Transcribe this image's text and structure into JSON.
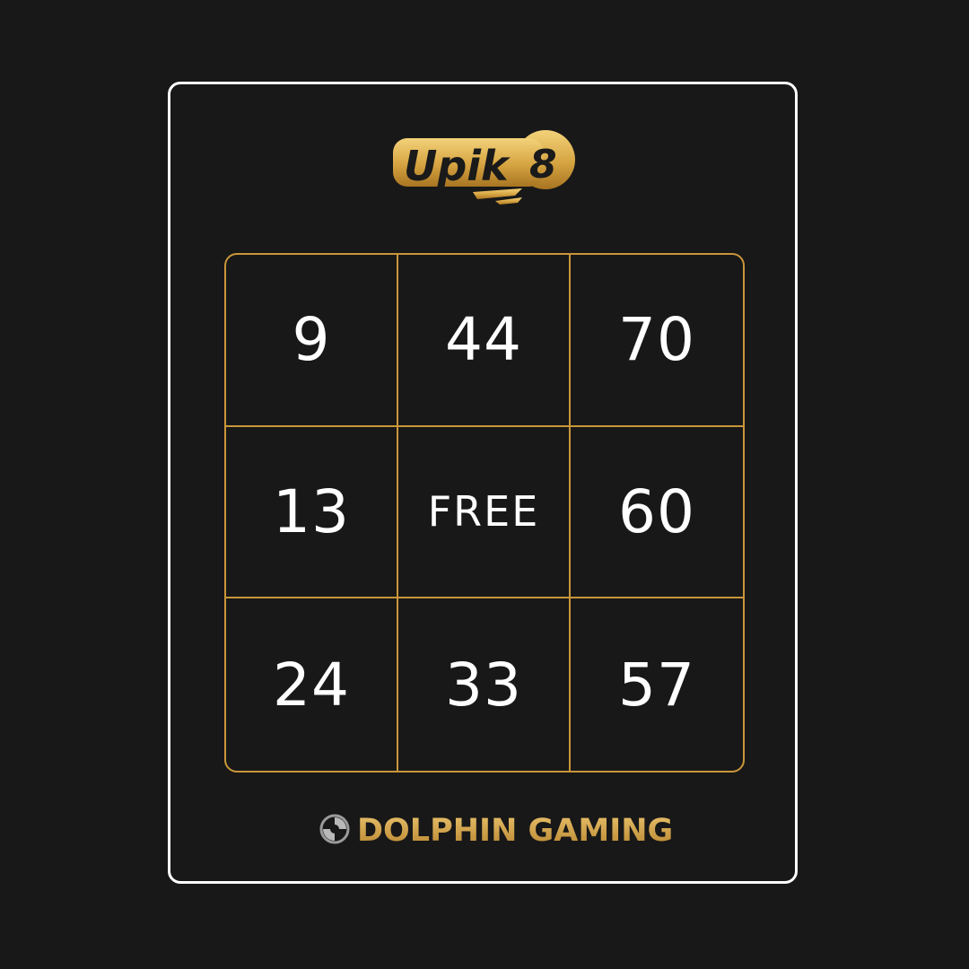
{
  "brand": {
    "logo_text": "Upik8",
    "footer_text": "DOLPHIN GAMING",
    "logo_icon": "dolphin-gaming-icon"
  },
  "colors": {
    "background": "#181818",
    "card_border": "#ffffff",
    "grid_gold": "#c9963a",
    "cell_text": "#ffffff"
  },
  "bingo": {
    "cells": [
      "9",
      "44",
      "70",
      "13",
      "FREE",
      "60",
      "24",
      "33",
      "57"
    ]
  }
}
